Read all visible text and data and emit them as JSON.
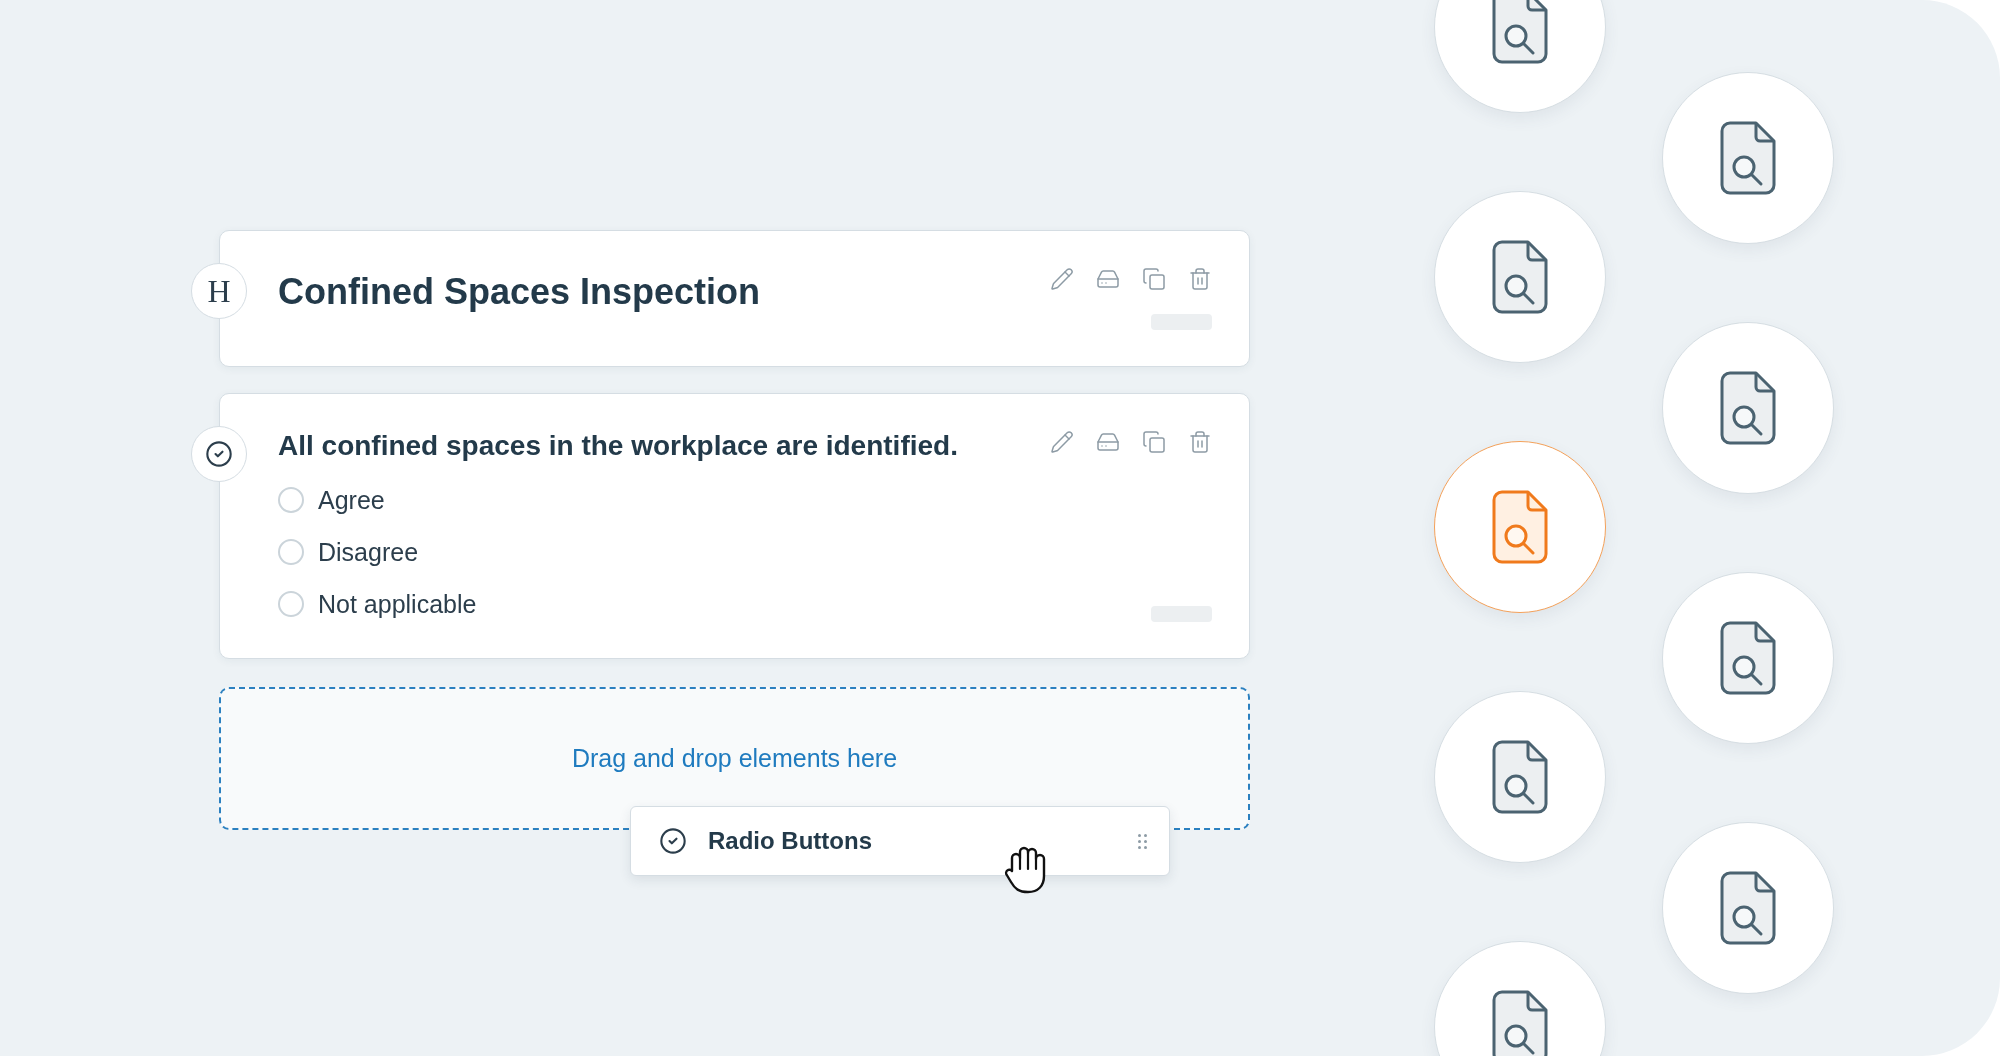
{
  "heading_card": {
    "badge": "H",
    "title": "Confined Spaces Inspection"
  },
  "question_card": {
    "question": "All confined spaces in the workplace are identified.",
    "options": [
      {
        "label": "Agree",
        "selected": false
      },
      {
        "label": "Disagree",
        "selected": false
      },
      {
        "label": "Not applicable",
        "selected": false
      }
    ]
  },
  "drop_zone": {
    "text": "Drag and drop elements here"
  },
  "dragged_element": {
    "label": "Radio Buttons"
  },
  "icon_columns": [
    {
      "items": [
        {
          "selected": false
        },
        {
          "selected": false
        },
        {
          "selected": true
        },
        {
          "selected": false
        },
        {
          "selected": false
        }
      ]
    },
    {
      "items": [
        {
          "selected": false
        },
        {
          "selected": false
        },
        {
          "selected": false
        },
        {
          "selected": false
        }
      ]
    }
  ]
}
